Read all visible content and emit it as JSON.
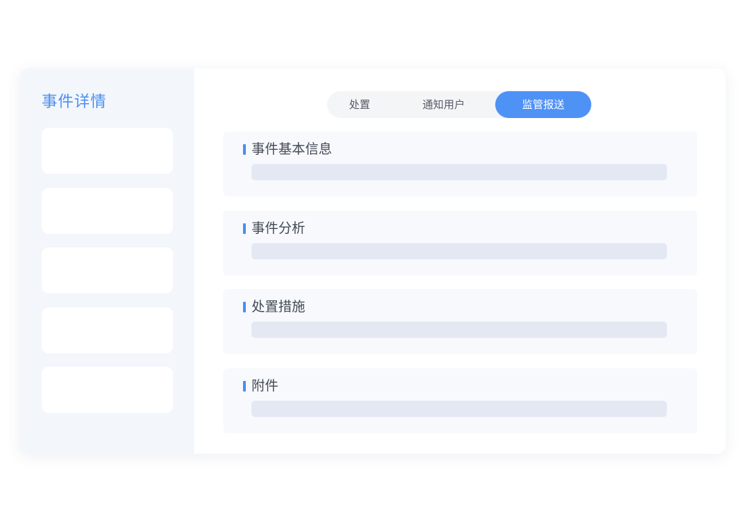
{
  "sidebar": {
    "title": "事件详情",
    "blocks": 5
  },
  "tabs": [
    {
      "label": "处置",
      "active": false
    },
    {
      "label": "通知用户",
      "active": false
    },
    {
      "label": "监管报送",
      "active": true
    }
  ],
  "sections": [
    {
      "title": "事件基本信息"
    },
    {
      "title": "事件分析"
    },
    {
      "title": "处置措施"
    },
    {
      "title": "附件"
    }
  ],
  "colors": {
    "accent": "#4f92f6",
    "sidebar_bg": "#f3f6fb",
    "section_bg": "#f7f9fd",
    "placeholder_bar": "#e3e8f3"
  }
}
